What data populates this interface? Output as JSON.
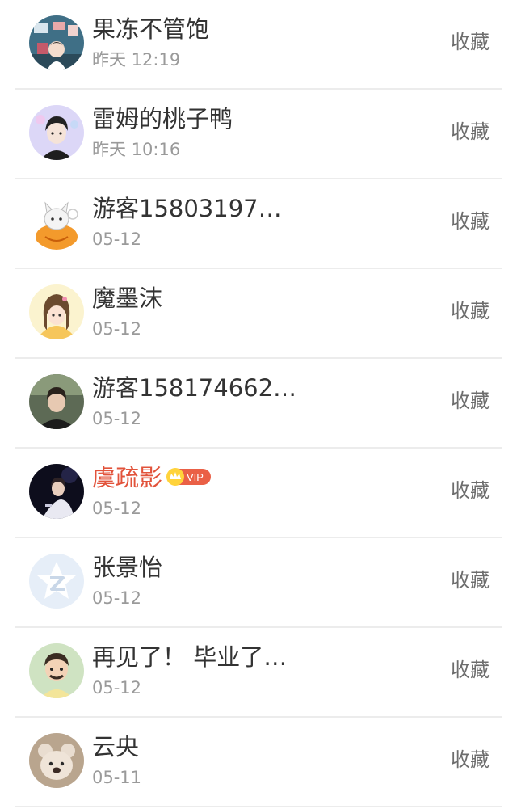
{
  "items": [
    {
      "name": "果冻不管饱",
      "time": "昨天 12:19",
      "action": "收藏",
      "avatar": "avatar-photo-room"
    },
    {
      "name": "雷姆的桃子鸭",
      "time": "昨天 10:16",
      "action": "收藏",
      "avatar": "avatar-anime-boy"
    },
    {
      "name": "游客15803197…",
      "time": "05-12",
      "action": "收藏",
      "avatar": "avatar-pumpkin-cat"
    },
    {
      "name": "魔墨沫",
      "time": "05-12",
      "action": "收藏",
      "avatar": "avatar-anime-girl"
    },
    {
      "name": "游客158174662…",
      "time": "05-12",
      "action": "收藏",
      "avatar": "avatar-photo-person"
    },
    {
      "name": "虞疏影",
      "time": "05-12",
      "action": "收藏",
      "avatar": "avatar-photo-stage",
      "vip": true,
      "vip_label": "VIP"
    },
    {
      "name": "张景怡",
      "time": "05-12",
      "action": "收藏",
      "avatar": "avatar-default-qq"
    },
    {
      "name": "再见了！ 毕业了…",
      "time": "05-12",
      "action": "收藏",
      "avatar": "avatar-cartoon-child"
    },
    {
      "name": "云央",
      "time": "05-11",
      "action": "收藏",
      "avatar": "avatar-teddy-bear"
    }
  ],
  "colors": {
    "name_text": "#333333",
    "vip_name_text": "#e2533b",
    "time_text": "#9a9a9a",
    "action_text": "#6d6d6d",
    "divider": "#ececec"
  }
}
